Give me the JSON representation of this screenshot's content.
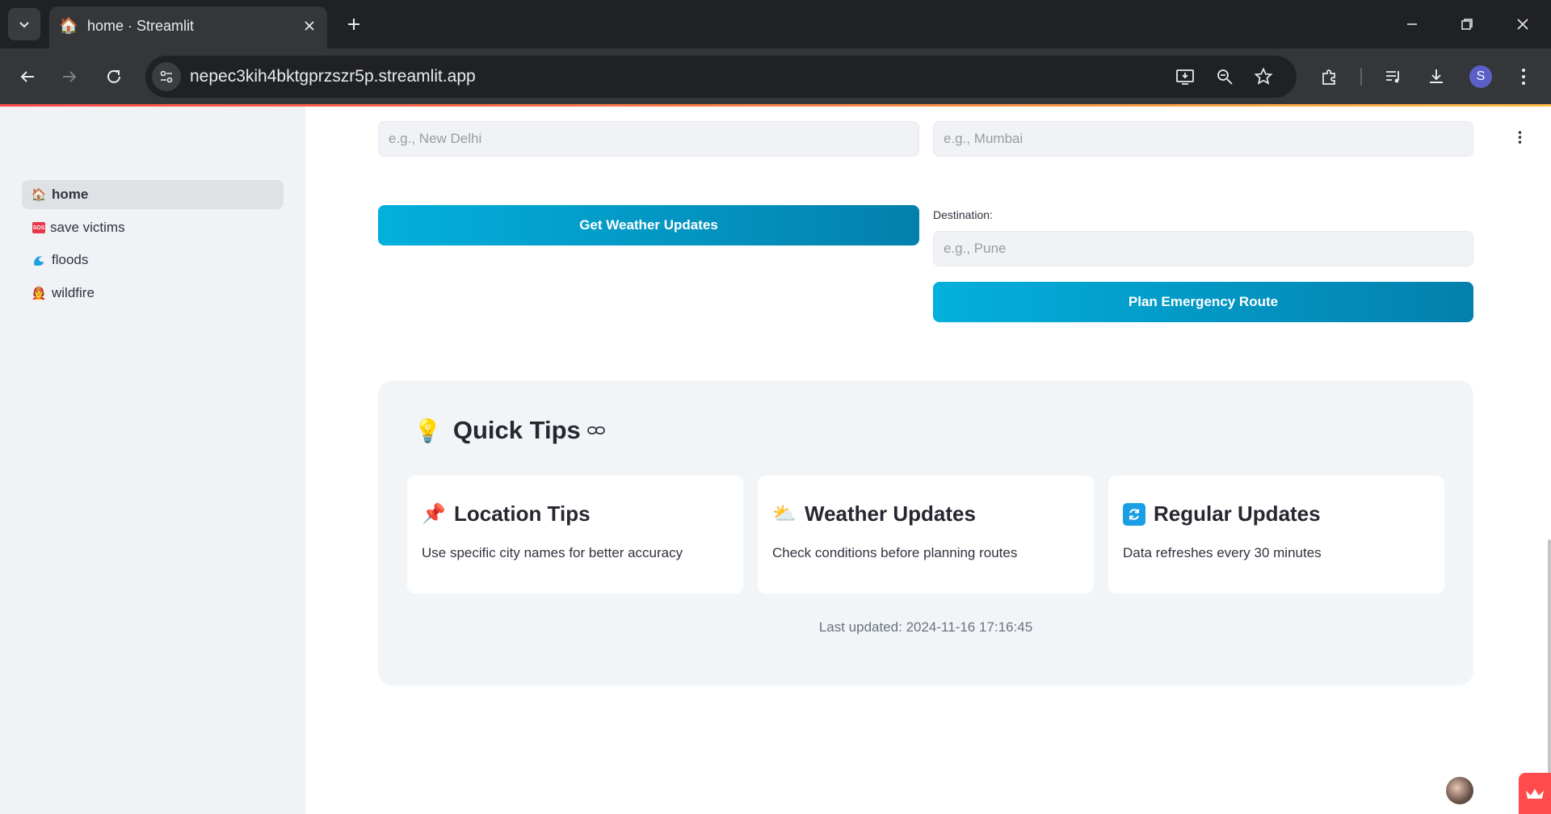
{
  "browser": {
    "tab_title": "home · Streamlit",
    "url": "nepec3kih4bktgprzszr5p.streamlit.app",
    "profile_initial": "S"
  },
  "sidebar": {
    "items": [
      {
        "label": "home",
        "icon": "house-emoji",
        "active": true
      },
      {
        "label": "save victims",
        "icon": "sos-emoji",
        "active": false
      },
      {
        "label": "floods",
        "icon": "wave-emoji",
        "active": false
      },
      {
        "label": "wildfire",
        "icon": "firefighter-emoji",
        "active": false
      }
    ]
  },
  "weather": {
    "city_placeholder": "e.g., New Delhi",
    "button_label": "Get Weather Updates"
  },
  "route": {
    "source_placeholder": "e.g., Mumbai",
    "destination_label": "Destination:",
    "destination_placeholder": "e.g., Pune",
    "button_label": "Plan Emergency Route"
  },
  "tips": {
    "heading": "Quick Tips",
    "cards": [
      {
        "title": "Location Tips",
        "icon": "pushpin-emoji",
        "body": "Use specific city names for better accuracy"
      },
      {
        "title": "Weather Updates",
        "icon": "sun-behind-cloud-emoji",
        "body": "Check conditions before planning routes"
      },
      {
        "title": "Regular Updates",
        "icon": "refresh-emoji",
        "body": "Data refreshes every 30 minutes"
      }
    ],
    "last_updated": "Last updated: 2024-11-16 17:16:45"
  },
  "colors": {
    "accent_start": "#03b0dc",
    "accent_end": "#0380ad",
    "streamlit_red": "#ff4b4b",
    "sidebar_bg": "#f0f2f6"
  }
}
